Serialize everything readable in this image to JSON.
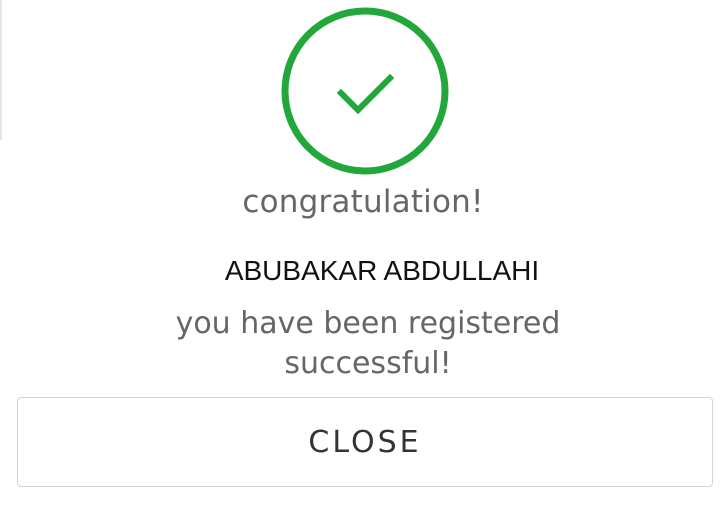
{
  "colors": {
    "success": "#22a83a",
    "muted_text": "#666666",
    "name_text": "#111111",
    "button_border": "#d4d4d4"
  },
  "dialog": {
    "icon": "success-check-icon",
    "title": "congratulation!",
    "user_name": "ABUBAKAR ABDULLAHI",
    "message_line1": "you have been registered",
    "message_line2": "successful!",
    "close_label": "CLOSE"
  }
}
